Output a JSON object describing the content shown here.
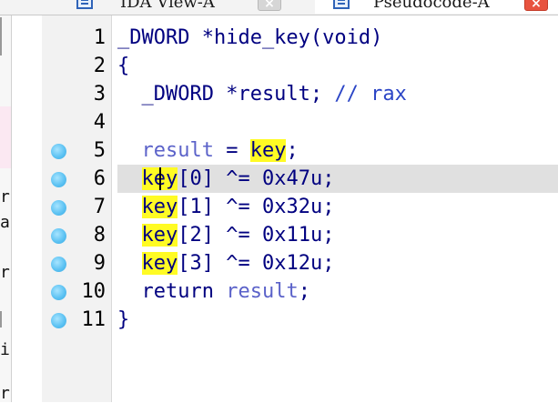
{
  "tabs": [
    {
      "label": "IDA View-A",
      "icon": "disassembly-window-icon",
      "active": false
    },
    {
      "label": "Pseudocode-A",
      "icon": "pseudocode-window-icon",
      "active": true
    }
  ],
  "close_glyph": "×",
  "side_panel_fragments": [
    "r",
    "a",
    "r",
    "i",
    "r"
  ],
  "editor": {
    "lines": [
      {
        "num": "1",
        "breakpoint": false,
        "tokens": [
          [
            "type",
            "_DWORD *hide_key(void)"
          ]
        ]
      },
      {
        "num": "2",
        "breakpoint": false,
        "tokens": [
          [
            "plain",
            "{"
          ]
        ]
      },
      {
        "num": "3",
        "breakpoint": false,
        "tokens": [
          [
            "plain",
            "  _DWORD *result; "
          ],
          [
            "cmt",
            "// rax"
          ]
        ]
      },
      {
        "num": "4",
        "breakpoint": false,
        "tokens": []
      },
      {
        "num": "5",
        "breakpoint": true,
        "tokens": [
          [
            "plain",
            "  "
          ],
          [
            "var",
            "result"
          ],
          [
            "plain",
            " = "
          ],
          [
            "key",
            "key"
          ],
          [
            "plain",
            ";"
          ]
        ]
      },
      {
        "num": "6",
        "breakpoint": true,
        "current": true,
        "tokens": [
          [
            "plain",
            "  "
          ],
          [
            "key",
            "key"
          ],
          [
            "plain",
            "[0] ^= 0x47u;"
          ]
        ]
      },
      {
        "num": "7",
        "breakpoint": true,
        "tokens": [
          [
            "plain",
            "  "
          ],
          [
            "key",
            "key"
          ],
          [
            "plain",
            "[1] ^= 0x32u;"
          ]
        ]
      },
      {
        "num": "8",
        "breakpoint": true,
        "tokens": [
          [
            "plain",
            "  "
          ],
          [
            "key",
            "key"
          ],
          [
            "plain",
            "[2] ^= 0x11u;"
          ]
        ]
      },
      {
        "num": "9",
        "breakpoint": true,
        "tokens": [
          [
            "plain",
            "  "
          ],
          [
            "key",
            "key"
          ],
          [
            "plain",
            "[3] ^= 0x12u;"
          ]
        ]
      },
      {
        "num": "10",
        "breakpoint": true,
        "tokens": [
          [
            "plain",
            "  return "
          ],
          [
            "var",
            "result"
          ],
          [
            "plain",
            ";"
          ]
        ]
      },
      {
        "num": "11",
        "breakpoint": true,
        "tokens": [
          [
            "plain",
            "}"
          ]
        ]
      }
    ]
  },
  "colors": {
    "code_text": "#000080",
    "variable": "#5b62c9",
    "comment": "#2b45c6",
    "search_highlight": "#fffb24",
    "current_line": "#e0e0e0",
    "breakpoint": "#5ec3f3"
  }
}
